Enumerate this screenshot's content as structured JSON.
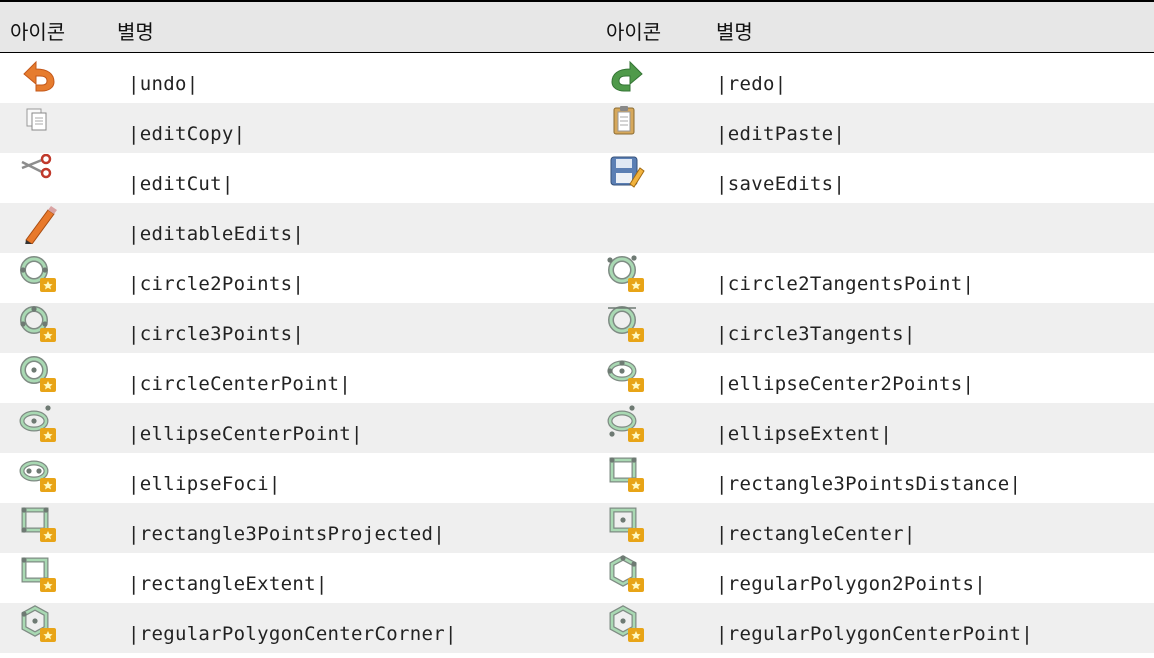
{
  "header": {
    "col_icon": "아이콘",
    "col_alias": "별명",
    "col_icon_2": "아이콘",
    "col_alias_2": "별명"
  },
  "rows": [
    {
      "left": {
        "icon": "undo-icon",
        "alias": "|undo|"
      },
      "right": {
        "icon": "redo-icon",
        "alias": "|redo|"
      }
    },
    {
      "left": {
        "icon": "edit-copy-icon",
        "alias": "|editCopy|"
      },
      "right": {
        "icon": "edit-paste-icon",
        "alias": "|editPaste|"
      }
    },
    {
      "left": {
        "icon": "edit-cut-icon",
        "alias": "|editCut|"
      },
      "right": {
        "icon": "save-edits-icon",
        "alias": "|saveEdits|"
      }
    },
    {
      "left": {
        "icon": "editable-edits-icon",
        "alias": "|editableEdits|"
      },
      "right": {
        "icon": "",
        "alias": ""
      }
    },
    {
      "left": {
        "icon": "circle-2-points-icon",
        "alias": "|circle2Points|"
      },
      "right": {
        "icon": "circle-2-tangents-point-icon",
        "alias": "|circle2TangentsPoint|"
      }
    },
    {
      "left": {
        "icon": "circle-3-points-icon",
        "alias": "|circle3Points|"
      },
      "right": {
        "icon": "circle-3-tangents-icon",
        "alias": "|circle3Tangents|"
      }
    },
    {
      "left": {
        "icon": "circle-center-point-icon",
        "alias": "|circleCenterPoint|"
      },
      "right": {
        "icon": "ellipse-center-2-points-icon",
        "alias": "|ellipseCenter2Points|"
      }
    },
    {
      "left": {
        "icon": "ellipse-center-point-icon",
        "alias": "|ellipseCenterPoint|"
      },
      "right": {
        "icon": "ellipse-extent-icon",
        "alias": "|ellipseExtent|"
      }
    },
    {
      "left": {
        "icon": "ellipse-foci-icon",
        "alias": "|ellipseFoci|"
      },
      "right": {
        "icon": "rectangle-3-points-distance-icon",
        "alias": "|rectangle3PointsDistance|"
      }
    },
    {
      "left": {
        "icon": "rectangle-3-points-projected-icon",
        "alias": "|rectangle3PointsProjected|"
      },
      "right": {
        "icon": "rectangle-center-icon",
        "alias": "|rectangleCenter|"
      }
    },
    {
      "left": {
        "icon": "rectangle-extent-icon",
        "alias": "|rectangleExtent|"
      },
      "right": {
        "icon": "regular-polygon-2-points-icon",
        "alias": "|regularPolygon2Points|"
      }
    },
    {
      "left": {
        "icon": "regular-polygon-center-corner-icon",
        "alias": "|regularPolygonCenterCorner|"
      },
      "right": {
        "icon": "regular-polygon-center-point-icon",
        "alias": "|regularPolygonCenterPoint|"
      }
    }
  ]
}
